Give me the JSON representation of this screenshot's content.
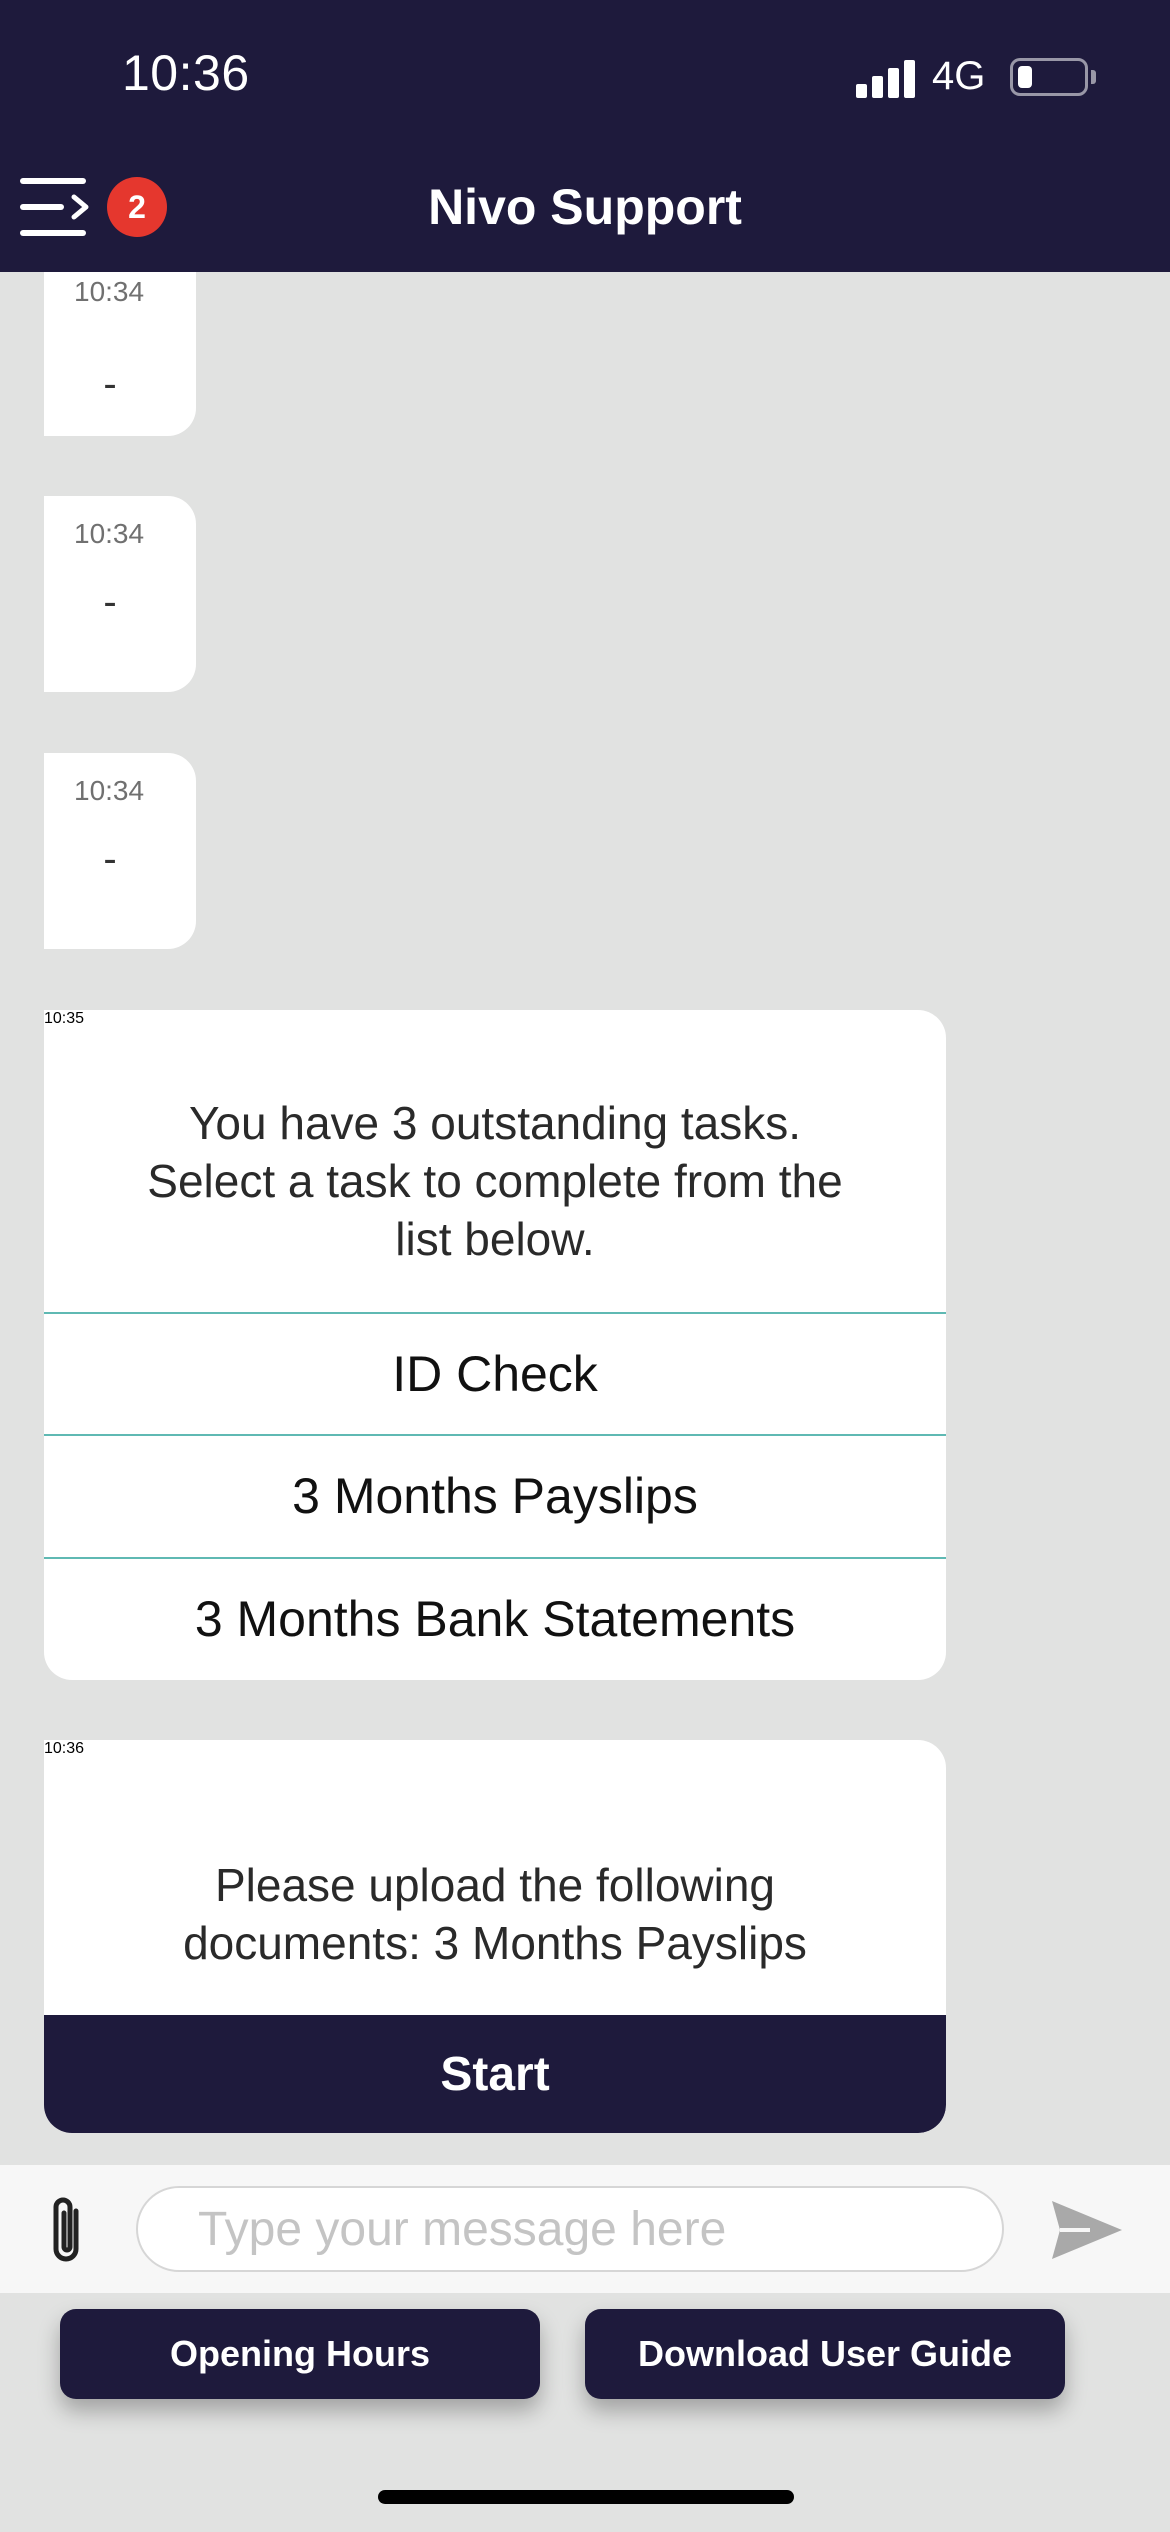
{
  "status_bar": {
    "time": "10:36",
    "network": "4G"
  },
  "header": {
    "title": "Nivo Support",
    "badge_count": "2"
  },
  "messages": [
    {
      "time": "10:34",
      "text": "-"
    },
    {
      "time": "10:34",
      "text": "-"
    },
    {
      "time": "10:34",
      "text": "-"
    }
  ],
  "tasks_card": {
    "time": "10:35",
    "text": "You have 3 outstanding tasks. Select a task to complete from the list below.",
    "tasks": [
      "ID Check",
      "3 Months Payslips",
      "3 Months Bank Statements"
    ]
  },
  "upload_card": {
    "time": "10:36",
    "text": "Please upload the following documents: 3 Months Payslips",
    "button_label": "Start"
  },
  "composer": {
    "placeholder": "Type your message here"
  },
  "quick_actions": {
    "opening_hours": "Opening Hours",
    "download_guide": "Download User Guide"
  },
  "colors": {
    "brand": "#1e1a3c",
    "background": "#e1e2e1",
    "badge": "#e5372e",
    "divider": "#5fb9b3"
  },
  "icons": {
    "menu": "menu-icon",
    "attach": "paperclip-icon",
    "send": "send-icon"
  }
}
